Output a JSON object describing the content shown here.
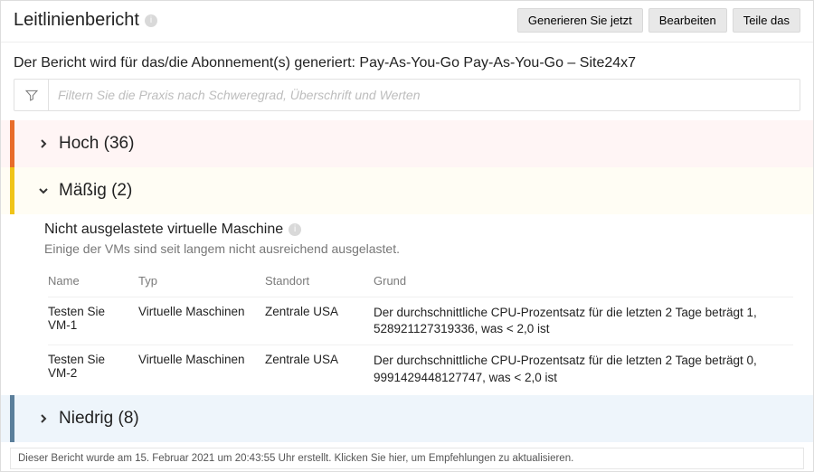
{
  "header": {
    "title": "Leitlinienbericht",
    "buttons": {
      "generate": "Generieren Sie jetzt",
      "edit": "Bearbeiten",
      "share": "Teile das"
    }
  },
  "subs_line": "Der Bericht wird für das/die Abonnement(s) generiert: Pay-As-You-Go Pay-As-You-Go – Site24x7",
  "filter": {
    "placeholder": "Filtern Sie die Praxis nach Schweregrad, Überschrift und Werten"
  },
  "sections": {
    "high": {
      "label": "Hoch",
      "count": 36
    },
    "moderate": {
      "label": "Mäßig",
      "count": 2
    },
    "low": {
      "label": "Niedrig",
      "count": 8
    }
  },
  "detail": {
    "title": "Nicht ausgelastete virtuelle Maschine",
    "desc": "Einige der VMs sind seit langem nicht ausreichend ausgelastet.",
    "columns": {
      "name": "Name",
      "type": "Typ",
      "location": "Standort",
      "reason": "Grund"
    },
    "rows": [
      {
        "name": "Testen Sie VM-1",
        "type": "Virtuelle Maschinen",
        "location": "Zentrale USA",
        "reason": "Der durchschnittliche CPU-Prozentsatz für die letzten 2 Tage beträgt 1, 528921127319336, was < 2,0 ist"
      },
      {
        "name": "Testen Sie VM-2",
        "type": "Virtuelle Maschinen",
        "location": "Zentrale USA",
        "reason": "Der durchschnittliche CPU-Prozentsatz für die letzten 2 Tage beträgt 0, 9991429448127747, was < 2,0 ist"
      }
    ]
  },
  "footer": "Dieser Bericht wurde am 15. Februar 2021 um 20:43:55 Uhr erstellt. Klicken Sie hier, um Empfehlungen zu aktualisieren."
}
